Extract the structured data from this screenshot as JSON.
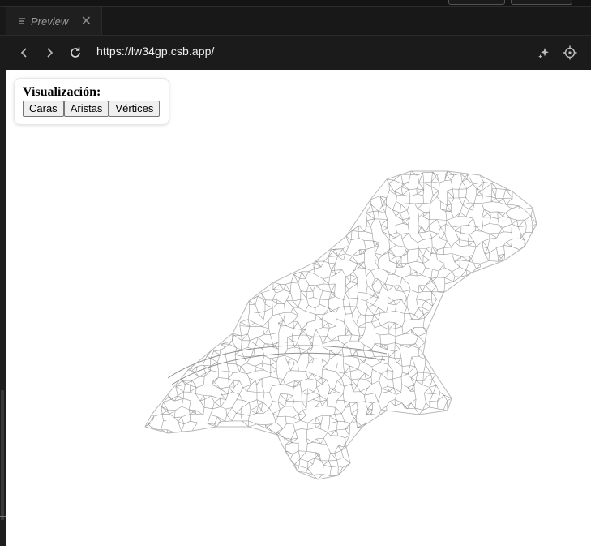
{
  "tab": {
    "title": "Preview",
    "close_glyph": "✕",
    "icon": "list-icon"
  },
  "navbar": {
    "url": "https://lw34gp.csb.app/",
    "icons": [
      "chevron-left-icon",
      "chevron-right-icon",
      "reload-icon",
      "sparkle-icon",
      "crosshair-icon"
    ]
  },
  "panel": {
    "title": "Visualización:",
    "buttons": [
      "Caras",
      "Aristas",
      "Vértices"
    ]
  },
  "model": {
    "render_mode": "wireframe",
    "stroke_color": "#9a9a9a"
  }
}
